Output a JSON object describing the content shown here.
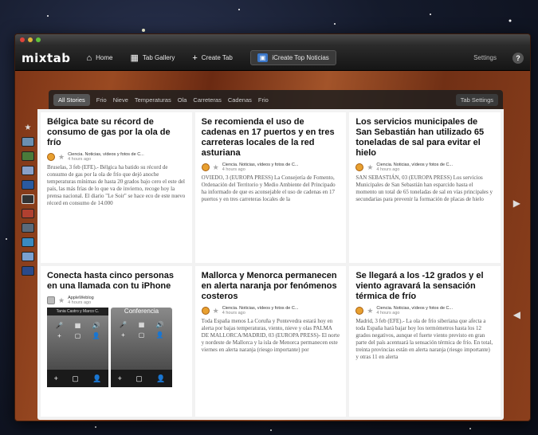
{
  "app": {
    "logo": "mixtab"
  },
  "nav": {
    "home": "Home",
    "gallery": "Tab Gallery",
    "create": "Create Tab",
    "active": "iCreate Top Noticias",
    "settings": "Settings",
    "help": "?"
  },
  "tabs": {
    "items": [
      "All Stories",
      "Frio",
      "Nieve",
      "Temperaturas",
      "Ola",
      "Carreteras",
      "Cadenas",
      "Frio"
    ],
    "settings": "Tab Settings"
  },
  "cards": [
    {
      "title": "Bélgica bate su récord de consumo de gas por la ola de frío",
      "source": "Ciencia. Noticias, vídeos y fotos de C...",
      "time": "4 hours ago",
      "body": "Bruselas, 3 feb (EFE).- Bélgica ha batido su récord de consumo de gas por la ola de frío que dejó anoche temperaturas mínimas de hasta 20 grados bajo cero el este del país, las más frías de lo que va de invierno, recoge hoy la prensa nacional. El diario \"Le Soir\" se hace eco de este nuevo récord en consumo de 14.000"
    },
    {
      "title": "Se recomienda el uso de cadenas en 17 puertos y en tres carreteras locales de la red asturiana",
      "source": "Ciencia. Noticias, vídeos y fotos de C...",
      "time": "4 hours ago",
      "body": "OVIEDO, 3 (EUROPA PRESS) La Consejería de Fomento, Ordenación del Territorio y Medio Ambiente del Principado ha informado de que es aconsejable el uso de cadenas en 17 puertos y en tres carreteras locales de la"
    },
    {
      "title": "Los servicios municipales de San Sebastián han utilizado 65 toneladas de sal para evitar el hielo",
      "source": "Ciencia. Noticias, vídeos y fotos de C...",
      "time": "4 hours ago",
      "body": "SAN SEBASTIÁN, 03 (EUROPA PRESS) Los servicios Municipales de San Sebastián han esparcido hasta el momento un total de 65 toneladas de sal en vías principales y secundarias para prevenir la formación de placas de hielo"
    },
    {
      "title": "Conecta hasta cinco personas en una llamada con tu iPhone",
      "source": "AppleWeblog",
      "time": "4 hours ago",
      "phone_header": "Tania Castro y Marco C.",
      "phone_title": "Conferencia"
    },
    {
      "title": "Mallorca y Menorca permanecen en alerta naranja por fenómenos costeros",
      "source": "Ciencia. Noticias, vídeos y fotos de C...",
      "time": "4 hours ago",
      "body": "Toda España menos La Coruña y Pontevedra estará hoy en alerta por bajas temperaturas, viento, nieve y olas PALMA DE MALLORCA/MADRID, 03 (EUROPA PRESS)- El norte y nordeste de Mallorca y la isla de Menorca permanecen este viernes en alerta naranja (riesgo importante) por"
    },
    {
      "title": "Se llegará a los -12 grados y el viento agravará la sensación térmica de frío",
      "source": "Ciencia. Noticias, vídeos y fotos de C...",
      "time": "4 hours ago",
      "body": "Madrid, 3 feb (EFE).- La ola de frío siberiana que afecta a toda España hará bajar hoy los termómetros hasta los 12 grados negativos, aunque el fuerte viento previsto en gran parte del país acentuará la sensación térmica de frío. En total, treinta provincias están en alerta naranja (riesgo importante) y otras 11 en alerta"
    }
  ]
}
